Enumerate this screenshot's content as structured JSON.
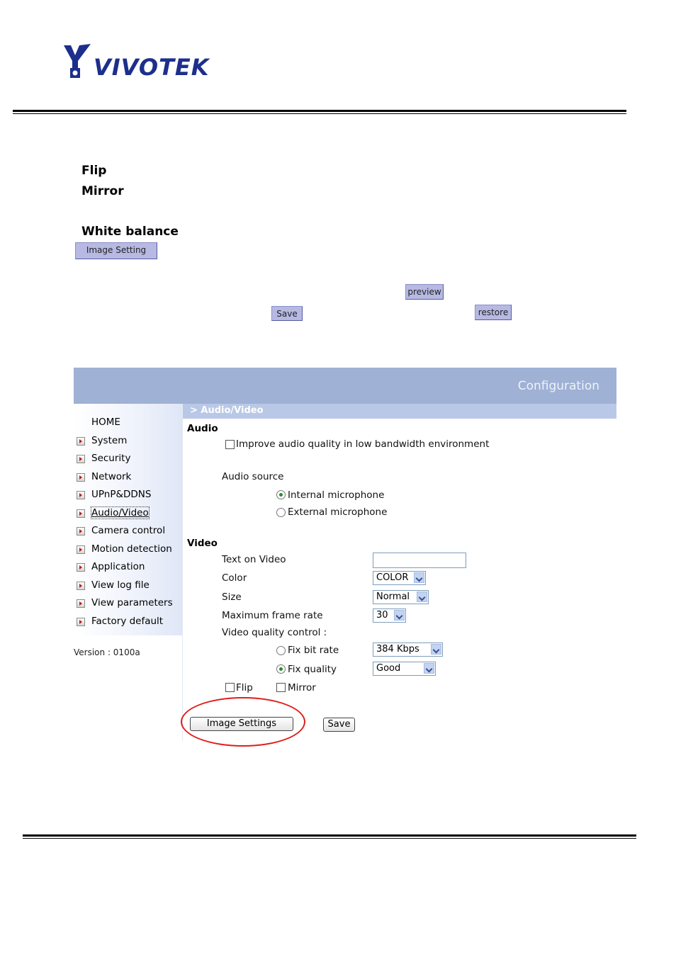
{
  "logo": {
    "text": "VIVOTEK"
  },
  "doc": {
    "terms": [
      "Flip",
      "Mirror",
      "White balance"
    ],
    "image_setting_button": "Image Setting",
    "preview_button": "preview",
    "save_button": "Save",
    "restore_button": "restore"
  },
  "config": {
    "banner_title": "Configuration",
    "breadcrumb": "> Audio/Video",
    "nav": [
      "HOME",
      "System",
      "Security",
      "Network",
      "UPnP&DDNS",
      "Audio/Video",
      "Camera control",
      "Motion detection",
      "Application",
      "View log file",
      "View parameters",
      "Factory default"
    ],
    "version": "Version : 0100a",
    "audio": {
      "title": "Audio",
      "improve_label": "Improve audio quality in low bandwidth environment",
      "improve_checked": false,
      "source_label": "Audio source",
      "internal_label": "Internal microphone",
      "external_label": "External microphone",
      "selected_source": "Internal microphone"
    },
    "video": {
      "title": "Video",
      "text_on_video_label": "Text on Video",
      "text_on_video_value": "",
      "color_label": "Color",
      "color_value": "COLOR",
      "size_label": "Size",
      "size_value": "Normal",
      "frame_rate_label": "Maximum frame rate",
      "frame_rate_value": "30",
      "quality_control_label": "Video quality control :",
      "fix_bit_rate_label": "Fix bit rate",
      "bit_rate_value": "384 Kbps",
      "fix_quality_label": "Fix quality",
      "quality_value": "Good",
      "selected_quality_mode": "Fix quality",
      "flip_label": "Flip",
      "mirror_label": "Mirror"
    },
    "image_settings_button": "Image Settings",
    "save_button": "Save"
  },
  "colors": {
    "banner": "#9fb1d4",
    "breadcrumb": "#b9c8e6",
    "annotation": "#e31b1b",
    "doc_button": "#b7b9e3"
  }
}
